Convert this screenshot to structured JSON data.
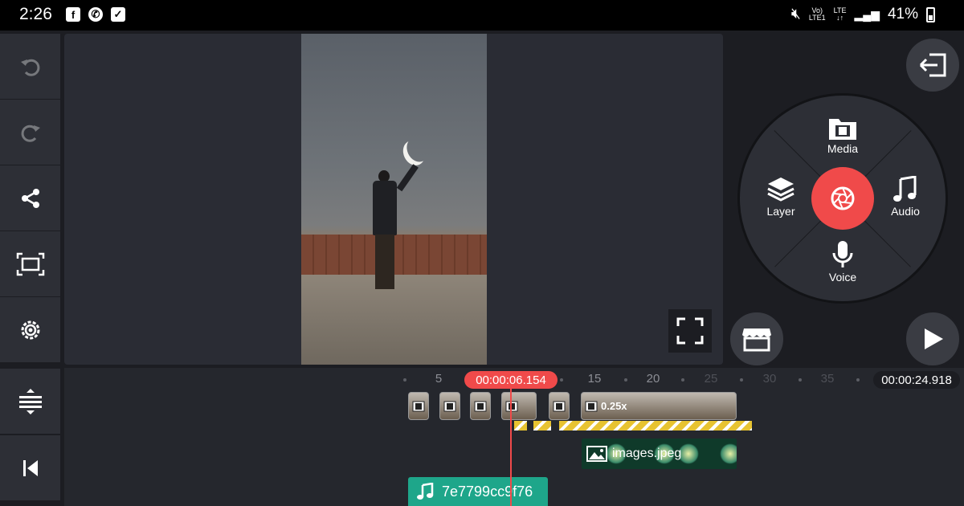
{
  "status_bar": {
    "time": "2:26",
    "volte_label": "Vo)",
    "lte1_label": "LTE1",
    "lte_label": "LTE",
    "battery": "41%"
  },
  "sidebar": {
    "items": [
      "undo-icon",
      "redo-icon",
      "share-icon",
      "aspect-ratio-icon",
      "settings-icon"
    ],
    "bottom_items": [
      "timeline-expand-icon",
      "skip-to-start-icon"
    ]
  },
  "menu_wheel": {
    "media": "Media",
    "layer": "Layer",
    "audio": "Audio",
    "voice": "Voice",
    "center_icon": "camera-shutter-icon"
  },
  "timeline": {
    "playhead_time": "00:00:06.154",
    "total_time": "00:00:24.918",
    "ticks": [
      "5",
      "15",
      "20",
      "25",
      "30",
      "35"
    ],
    "speed_label": "0.25x",
    "image_layer_name": "images.jpeg",
    "audio_clip_name": "7e7799cc9f76"
  },
  "colors": {
    "accent": "#f04a4a",
    "audio_clip": "#1ea68a",
    "panel": "#2d2f36",
    "background": "#1c1d22"
  }
}
